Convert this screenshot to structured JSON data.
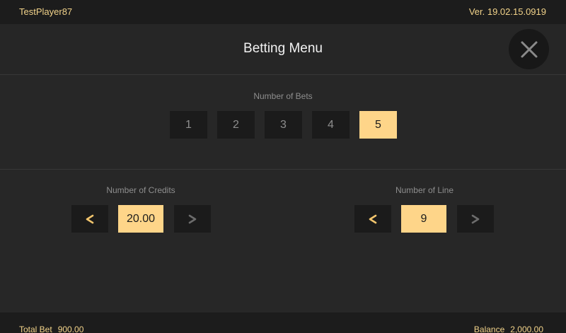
{
  "header": {
    "player_name": "TestPlayer87",
    "version": "Ver. 19.02.15.0919"
  },
  "menu": {
    "title": "Betting Menu"
  },
  "bets": {
    "label": "Number of Bets",
    "options": [
      "1",
      "2",
      "3",
      "4",
      "5"
    ],
    "selected": "5"
  },
  "credits": {
    "label": "Number of Credits",
    "value": "20.00"
  },
  "lines": {
    "label": "Number of Line",
    "value": "9"
  },
  "footer": {
    "total_bet_label": "Total Bet",
    "total_bet_value": "900.00",
    "balance_label": "Balance",
    "balance_value": "2,000.00"
  },
  "colors": {
    "accent": "#fed589",
    "text_gold": "#f2d38a",
    "button_bg": "#1b1b1b",
    "panel_bg": "#272727"
  },
  "icons": {
    "close": "close-icon",
    "decrease": "chevron-left-icon",
    "increase": "chevron-right-icon"
  }
}
